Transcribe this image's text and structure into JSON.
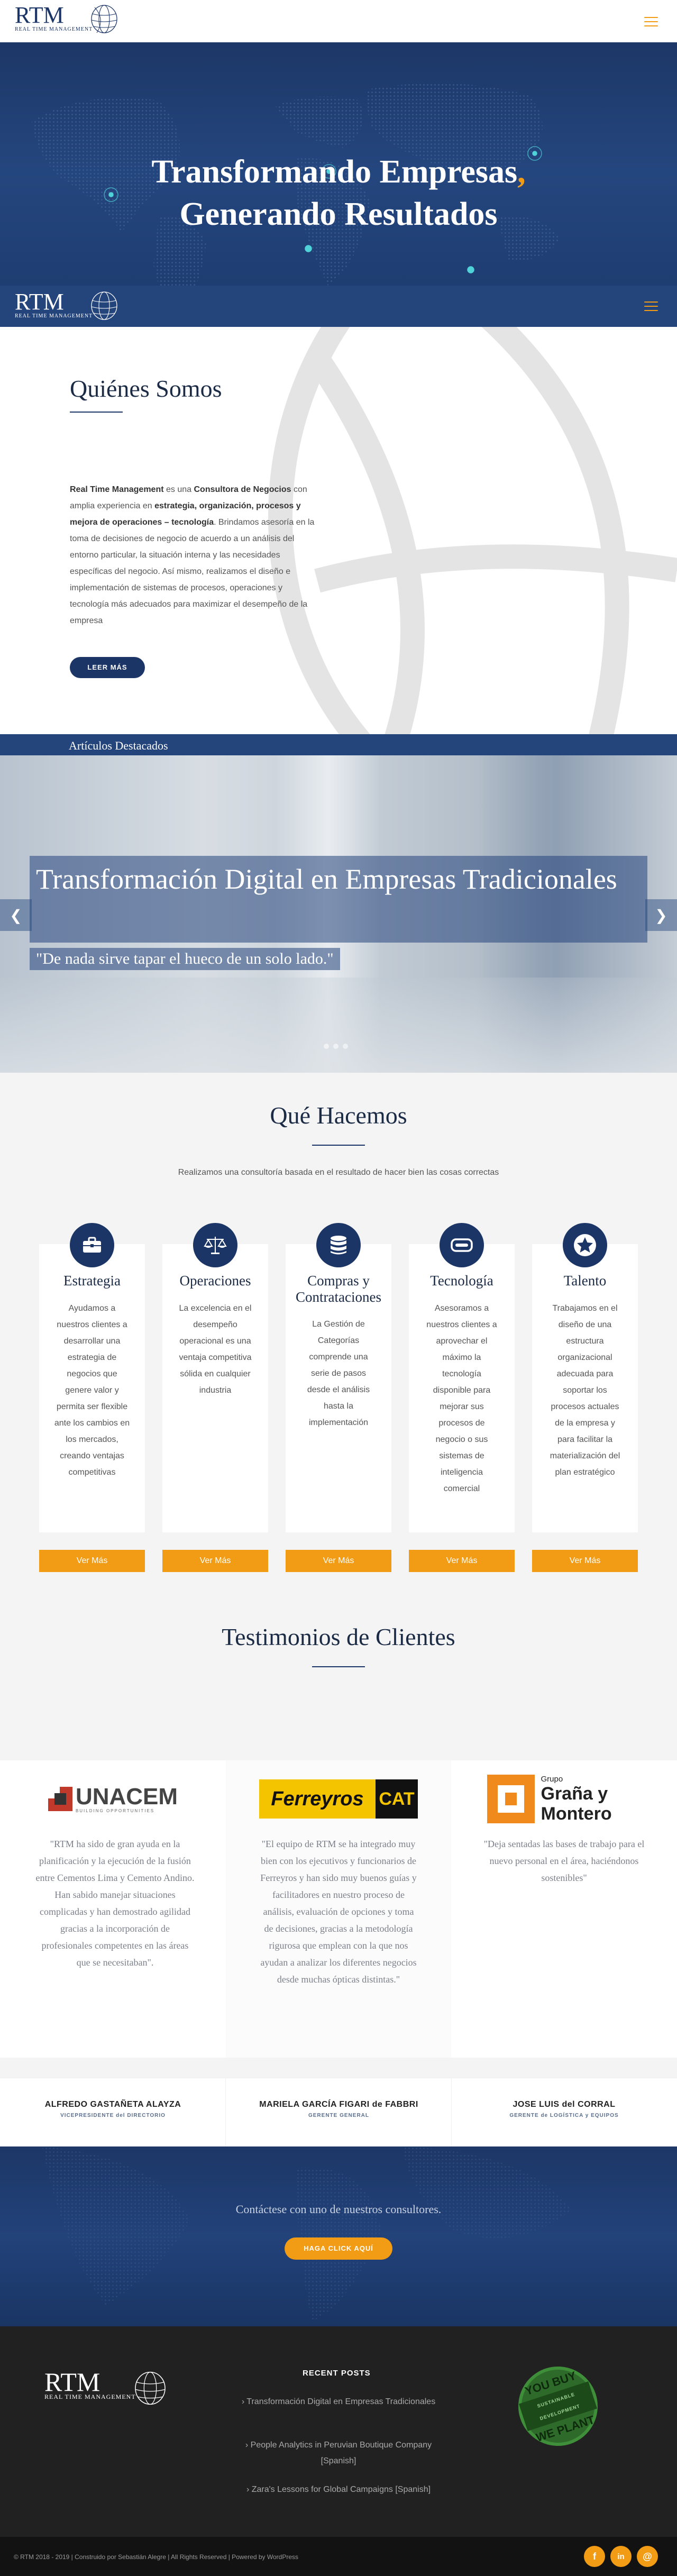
{
  "header": {
    "logo_text": "RTM",
    "logo_subtext": "REAL TIME MANAGEMENT",
    "menu_icon": "hamburger-icon"
  },
  "hero": {
    "title_line1": "Transformando Empresas",
    "title_dot": ",",
    "title_line2": "Generando Resultados"
  },
  "about": {
    "title": "Quiénes Somos",
    "p_bold1": "Real Time Management",
    "p_text1": " es una ",
    "p_bold2": "Consultora de Negocios",
    "p_text2": " con amplia experiencia en ",
    "p_bold3": "estrategia, organización, procesos y mejora de operaciones – tecnología",
    "p_text3": ". Brindamos asesoría en la toma de decisiones de negocio de acuerdo a un análisis del entorno particular, la situación interna y las necesidades específicas del negocio. Así mismo, realizamos el diseño e implementación de sistemas de procesos, operaciones y tecnología más adecuados para maximizar el desempeño de la empresa",
    "button": "LEER MÁS"
  },
  "articles": {
    "bar_title": "Artículos Destacados",
    "slide_title": "Transformación Digital en Empresas Tradicionales",
    "slide_quote": "\"De nada sirve tapar el hueco de un solo lado.\"",
    "prev_icon": "chevron-left-icon",
    "next_icon": "chevron-right-icon"
  },
  "services": {
    "title": "Qué Hacemos",
    "intro": "Realizamos una consultoría basada en el resultado de hacer bien las cosas correctas",
    "button_label": "Ver Más",
    "cards": [
      {
        "title": "Estrategia",
        "icon": "briefcase-icon",
        "text": "Ayudamos a nuestros clientes a desarrollar una estrategia de negocios que genere valor y permita ser flexible ante los cambios en los mercados, creando ventajas competitivas"
      },
      {
        "title": "Operaciones",
        "icon": "balance-scale-icon",
        "text": "La excelencia en el desempeño operacional es una ventaja competitiva sólida en cualquier industria"
      },
      {
        "title": "Compras y Contrataciones",
        "icon": "database-icon",
        "text": "La Gestión de Categorías comprende una serie de pasos desde el análisis hasta la implementación"
      },
      {
        "title": "Tecnología",
        "icon": "hard-drive-icon",
        "text": "Asesoramos a nuestros clientes a aprovechar el máximo la tecnología disponible para mejorar sus procesos de negocio o sus sistemas de inteligencia comercial"
      },
      {
        "title": "Talento",
        "icon": "star-icon",
        "text": "Trabajamos en el diseño de una estructura organizacional adecuada para soportar los procesos actuales de la empresa y para facilitar la materialización del plan estratégico"
      }
    ]
  },
  "testimonials": {
    "title": "Testimonios de Clientes",
    "items": [
      {
        "logo": "UNACEM",
        "logo_sub": "BUILDING OPPORTUNITIES",
        "quote": "\"RTM ha sido de gran ayuda en la planificación y la ejecución de la fusión entre Cementos Lima y Cemento Andino. Han sabido manejar situaciones complicadas y han demostrado agilidad gracias a la incorporación de profesionales competentes en las áreas que se necesitaban\".",
        "name": "ALFREDO GASTAÑETA ALAYZA",
        "role": "VICEPRESIDENTE del DIRECTORIO"
      },
      {
        "logo": "Ferreyros",
        "logo_cat": "CAT",
        "quote": "\"El equipo de RTM se ha integrado muy bien con los ejecutivos y funcionarios de Ferreyros y han sido muy buenos guías y facilitadores en nuestro proceso de análisis, evaluación de opciones y toma de decisiones, gracias a la metodología rigurosa que emplean con la que nos ayudan a analizar los diferentes negocios desde muchas ópticas distintas.\"",
        "name": "MARIELA GARCÍA FIGARI de FABBRI",
        "role": "GERENTE GENERAL"
      },
      {
        "logo_small": "Grupo",
        "logo": "Graña y Montero",
        "quote": "\"Deja sentadas las bases de trabajo para el nuevo personal en el área, haciéndonos sostenibles\"",
        "name": "JOSE LUIS del CORRAL",
        "role": "GERENTE de LOGÍSTICA y EQUIPOS"
      }
    ]
  },
  "cta": {
    "text": "Contáctese con uno de nuestros consultores.",
    "button": "HAGA CLICK AQUÍ"
  },
  "footer": {
    "recent_title": "RECENT POSTS",
    "posts": [
      "Transformación Digital en Empresas Tradicionales",
      "People Analytics in Peruvian Boutique Company [Spanish]",
      "Zara's Lessons for Global Campaigns [Spanish]"
    ],
    "badge_top": "YOU BUY",
    "badge_mid": "SUSTAINABLE DEVELOPMENT",
    "badge_bottom": "WE PLANT",
    "copyright": "© RTM 2018 - 2019  |  Construido por Sebastián Alegre  |  All Rights Reserved  |  Powered by WordPress",
    "social": [
      {
        "icon": "facebook-icon",
        "glyph": "f"
      },
      {
        "icon": "linkedin-icon",
        "glyph": "in"
      },
      {
        "icon": "email-icon",
        "glyph": "@"
      }
    ]
  },
  "colors": {
    "navy": "#1b3566",
    "blue_bar": "#24447c",
    "accent_orange": "#f29b14",
    "footer_dark": "#212121"
  }
}
